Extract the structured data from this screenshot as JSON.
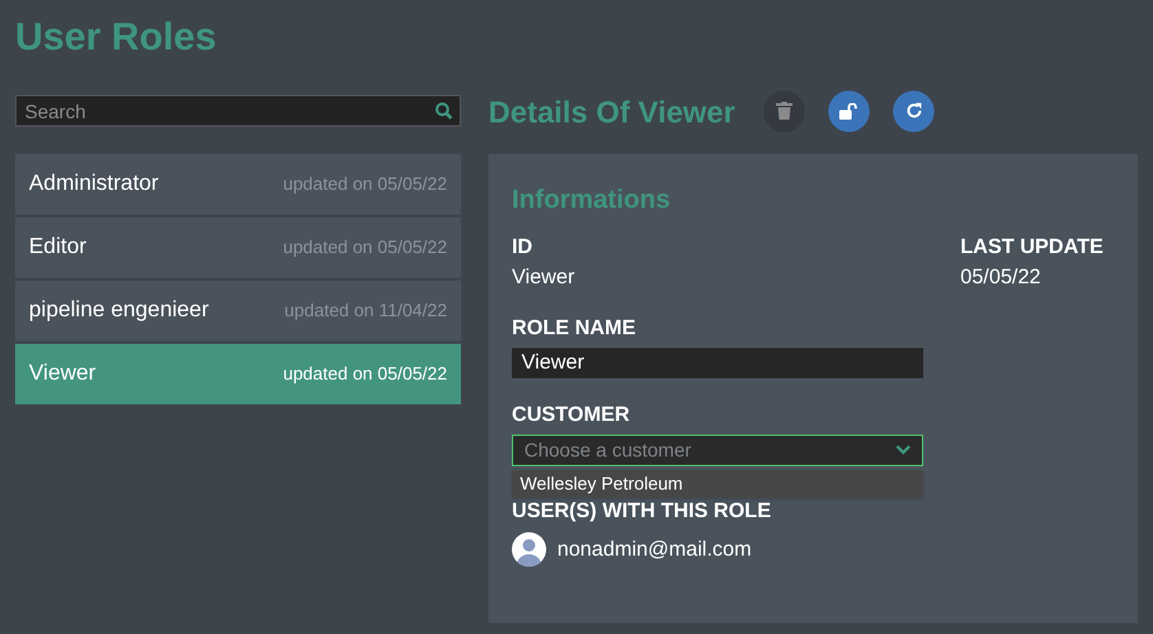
{
  "page_title": "User Roles",
  "search": {
    "placeholder": "Search"
  },
  "roles": [
    {
      "name": "Administrator",
      "updated": "updated on 05/05/22",
      "selected": false
    },
    {
      "name": "Editor",
      "updated": "updated on 05/05/22",
      "selected": false
    },
    {
      "name": "pipeline engenieer",
      "updated": "updated on 11/04/22",
      "selected": false
    },
    {
      "name": "Viewer",
      "updated": "updated on 05/05/22",
      "selected": true
    }
  ],
  "details": {
    "title": "Details Of Viewer",
    "actions": [
      {
        "kind": "delete",
        "disabled": true
      },
      {
        "kind": "unlock",
        "disabled": false
      },
      {
        "kind": "refresh",
        "disabled": false
      }
    ],
    "section_title": "Informations",
    "id_label": "ID",
    "id_value": "Viewer",
    "last_update_label": "LAST UPDATE",
    "last_update_value": "05/05/22",
    "role_name_label": "ROLE NAME",
    "role_name_value": "Viewer",
    "customer_label": "CUSTOMER",
    "customer_placeholder": "Choose a customer",
    "customer_options": [
      "Wellesley Petroleum"
    ],
    "users_label": "USER(S) WITH THIS ROLE",
    "users": [
      {
        "email": "nonadmin@mail.com"
      }
    ]
  }
}
